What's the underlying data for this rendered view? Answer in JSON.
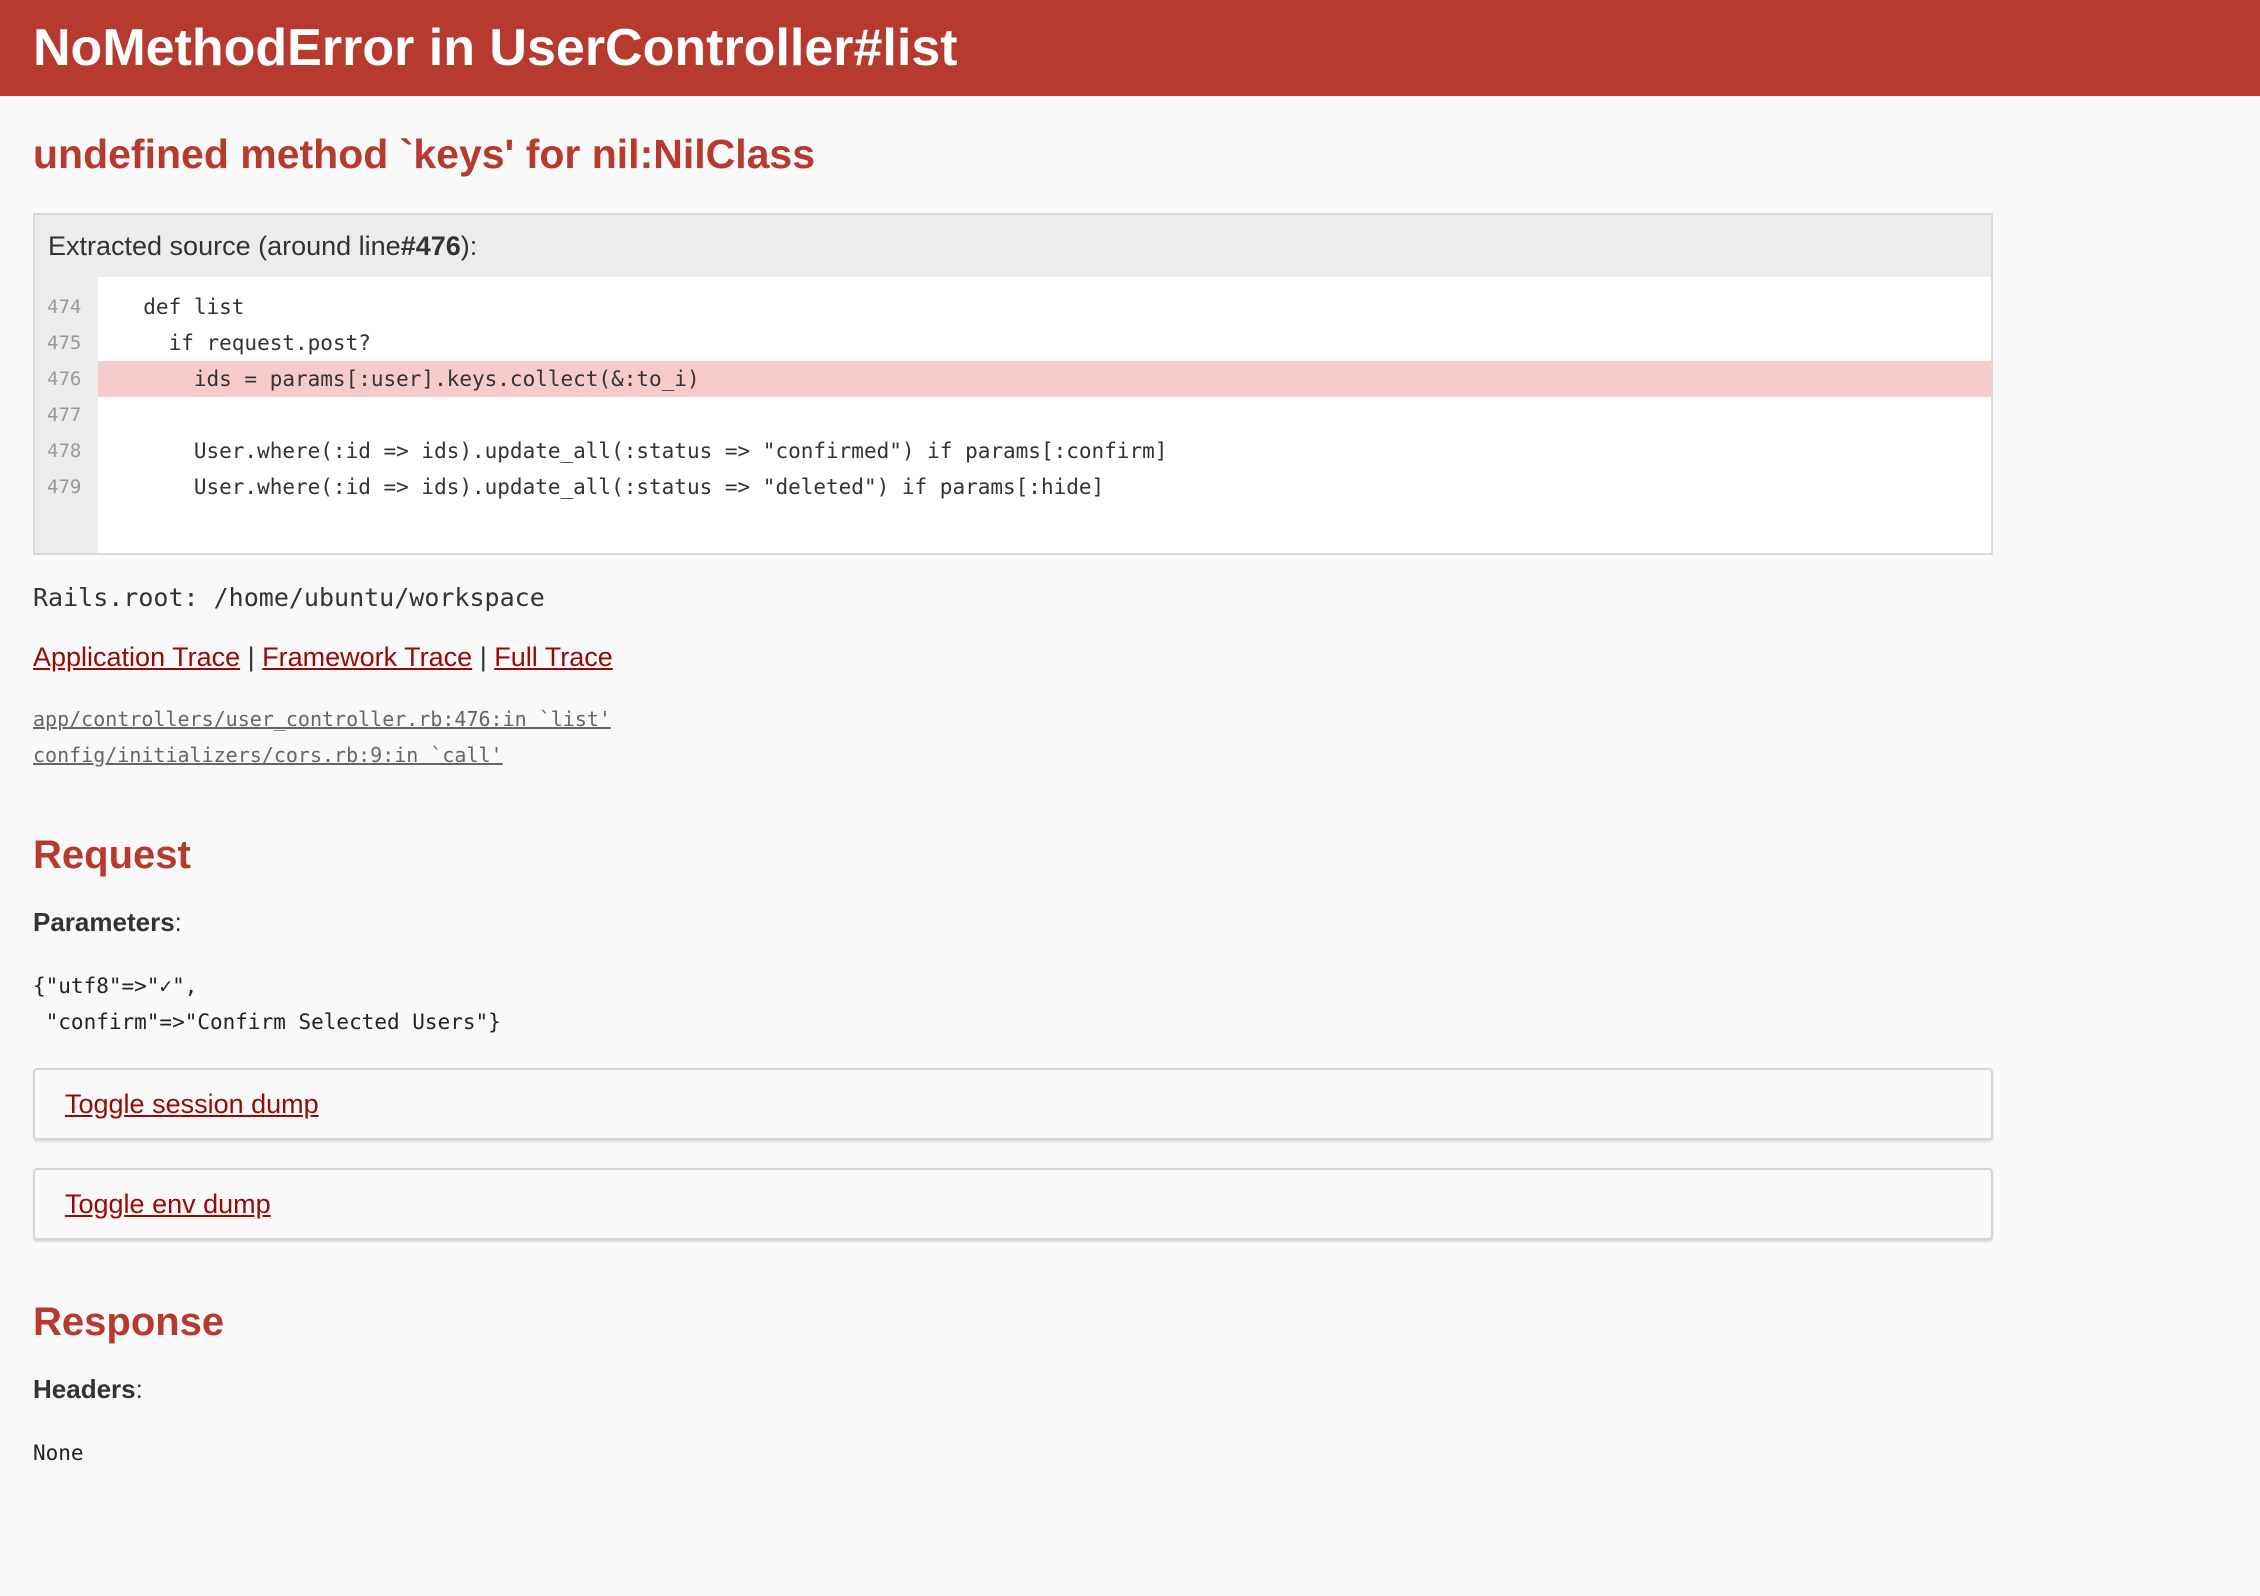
{
  "header": {
    "title": "NoMethodError in UserController#list"
  },
  "error": {
    "message": "undefined method `keys' for nil:NilClass"
  },
  "source": {
    "info_prefix": "Extracted source (around line ",
    "info_line": "#476",
    "info_suffix": "):",
    "lines": [
      {
        "num": "474",
        "code": "  def list"
      },
      {
        "num": "475",
        "code": "    if request.post?"
      },
      {
        "num": "476",
        "code": "      ids = params[:user].keys.collect(&:to_i)",
        "highlight": true
      },
      {
        "num": "477",
        "code": ""
      },
      {
        "num": "478",
        "code": "      User.where(:id => ids).update_all(:status => \"confirmed\") if params[:confirm]"
      },
      {
        "num": "479",
        "code": "      User.where(:id => ids).update_all(:status => \"deleted\") if params[:hide]"
      }
    ]
  },
  "rails_root": "Rails.root: /home/ubuntu/workspace",
  "traces": {
    "application": "Application Trace",
    "framework": "Framework Trace",
    "full": "Full Trace",
    "separator": " | ",
    "lines": [
      "app/controllers/user_controller.rb:476:in `list'",
      "config/initializers/cors.rb:9:in `call'"
    ]
  },
  "request": {
    "heading": "Request",
    "parameters_label": "Parameters",
    "parameters_colon": ":",
    "parameters_dump": "{\"utf8\"=>\"✓\",\n \"confirm\"=>\"Confirm Selected Users\"}",
    "toggle_session": "Toggle session dump",
    "toggle_env": "Toggle env dump"
  },
  "response": {
    "heading": "Response",
    "headers_label": "Headers",
    "headers_colon": ":",
    "headers_dump": "None"
  }
}
